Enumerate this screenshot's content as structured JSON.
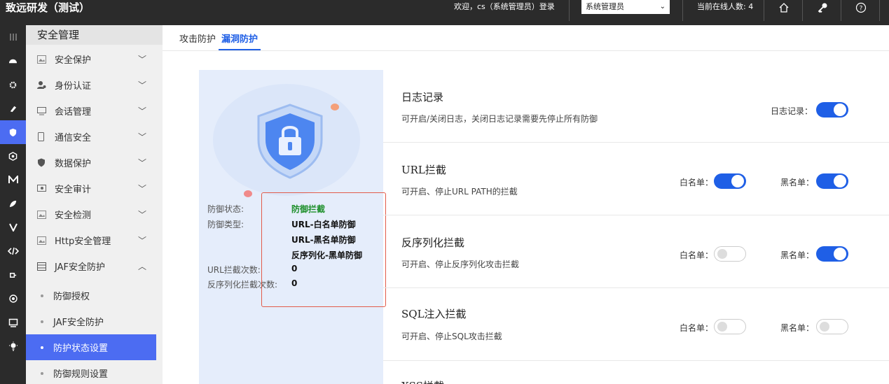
{
  "app": {
    "title": "致远研发（测试）",
    "welcome": "欢迎，cs（系统管理员）登录",
    "role_selected": "系统管理员",
    "online_count": "当前在线人数: 4",
    "icons": [
      "home-icon",
      "key-icon",
      "help-icon"
    ]
  },
  "rail": {
    "icons": [
      "menu-icon",
      "dashboard-icon",
      "settings-icon",
      "brush-icon",
      "shield-icon",
      "hexagon-icon",
      "m-icon",
      "leaf-icon",
      "v-icon",
      "code-icon",
      "plugin-icon",
      "gear-icon",
      "monitor-icon",
      "bulb-icon"
    ],
    "active_index": 4
  },
  "menu": {
    "title": "安全管理",
    "items": [
      {
        "label": "安全保护",
        "icon": "image-icon"
      },
      {
        "label": "身份认证",
        "icon": "user-icon"
      },
      {
        "label": "会话管理",
        "icon": "monitor-icon"
      },
      {
        "label": "通信安全",
        "icon": "phone-icon"
      },
      {
        "label": "数据保护",
        "icon": "shield-icon"
      },
      {
        "label": "安全审计",
        "icon": "audit-icon"
      },
      {
        "label": "安全检测",
        "icon": "image-icon"
      },
      {
        "label": "Http安全管理",
        "icon": "image-icon"
      },
      {
        "label": "JAF安全防护",
        "icon": "server-icon"
      }
    ],
    "subitems": [
      {
        "label": "防御授权"
      },
      {
        "label": "JAF安全防护"
      },
      {
        "label": "防护状态设置"
      },
      {
        "label": "防御规则设置"
      }
    ],
    "active_sub": 2
  },
  "tabs": [
    {
      "label": "攻击防护"
    },
    {
      "label": "漏洞防护"
    }
  ],
  "status_card": {
    "status_label": "防御状态:",
    "status_value": "防御拦截",
    "type_label": "防御类型:",
    "types": [
      "URL-白名单防御",
      "URL-黑名单防御",
      "反序列化-黑单防御"
    ],
    "url_count_label": "URL拦截次数:",
    "url_count": "0",
    "deser_count_label": "反序列化拦截次数:",
    "deser_count": "0",
    "status_color": "#1d8f2a"
  },
  "rows": [
    {
      "title": "日志记录",
      "desc": "可开启/关闭日志，关闭日志记录需要先停止所有防御",
      "switch_label": "日志记录：",
      "switch_on": true
    },
    {
      "title": "URL拦截",
      "desc": "可开启、停止URL PATH的拦截",
      "whitelist_label": "白名单：",
      "whitelist_on": true,
      "blacklist_label": "黑名单：",
      "blacklist_on": true
    },
    {
      "title": "反序列化拦截",
      "desc": "可开启、停止反序列化攻击拦截",
      "whitelist_label": "白名单：",
      "whitelist_on": false,
      "blacklist_label": "黑名单：",
      "blacklist_on": true
    },
    {
      "title": "SQL注入拦截",
      "desc": "可开启、停止SQL攻击拦截",
      "whitelist_label": "白名单：",
      "whitelist_on": false,
      "blacklist_label": "黑名单：",
      "blacklist_on": false
    },
    {
      "title": "XSS拦截"
    }
  ],
  "colors": {
    "accent": "#1f5fe6",
    "menu_active": "#4c6cf2",
    "topbar": "#2b2b2b",
    "highlight": "#e25b4a"
  }
}
